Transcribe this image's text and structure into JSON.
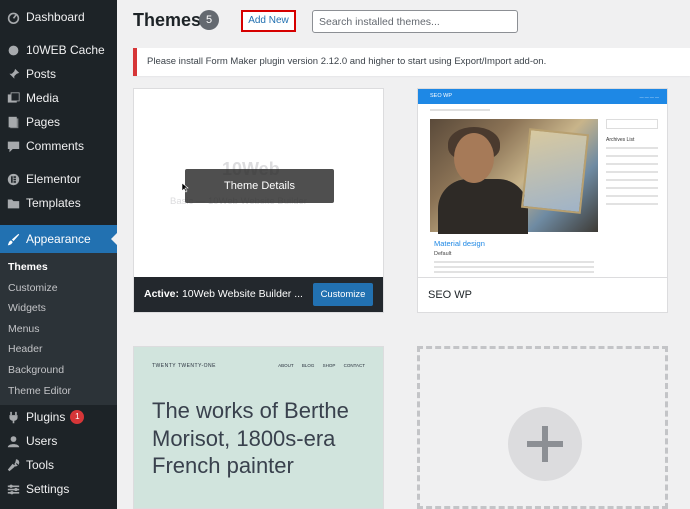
{
  "sidebar": {
    "items": [
      {
        "label": "Dashboard",
        "icon": "dashboard-icon"
      },
      {
        "label": "10WEB Cache",
        "icon": "cache-icon"
      },
      {
        "label": "Posts",
        "icon": "pin-icon"
      },
      {
        "label": "Media",
        "icon": "media-icon"
      },
      {
        "label": "Pages",
        "icon": "pages-icon"
      },
      {
        "label": "Comments",
        "icon": "comments-icon"
      },
      {
        "label": "Elementor",
        "icon": "elementor-icon"
      },
      {
        "label": "Templates",
        "icon": "folder-icon"
      },
      {
        "label": "Appearance",
        "icon": "brush-icon"
      },
      {
        "label": "Plugins",
        "icon": "plug-icon",
        "badge": "1"
      },
      {
        "label": "Users",
        "icon": "users-icon"
      },
      {
        "label": "Tools",
        "icon": "wrench-icon"
      },
      {
        "label": "Settings",
        "icon": "settings-icon"
      }
    ],
    "appearance_submenu": [
      "Themes",
      "Customize",
      "Widgets",
      "Menus",
      "Header",
      "Background",
      "Theme Editor"
    ]
  },
  "header": {
    "title": "Themes",
    "count": "5",
    "add_new": "Add New",
    "search_placeholder": "Search installed themes..."
  },
  "notice": {
    "text": "Please install Form Maker plugin version 2.12.0 and higher to start using Export/Import add-on."
  },
  "themes": {
    "active": {
      "details_label": "Theme Details",
      "watermark": "10Web",
      "faint_title": "Basic — 10Web Website Builder",
      "active_prefix": "Active:",
      "name": "10Web Website Builder ...",
      "customize_label": "Customize"
    },
    "seo": {
      "name": "SEO WP",
      "preview_brand": "SEO WP",
      "preview_post_title": "Material design",
      "preview_post_sub": "Default",
      "preview_widget_title": "Archives List"
    },
    "twenty_one": {
      "brand": "TWENTY TWENTY-ONE",
      "nav": [
        "ABOUT",
        "BLOG",
        "SHOP",
        "CONTACT"
      ],
      "heading": "The works of Berthe Morisot, 1800s-era French painter"
    }
  },
  "colors": {
    "sidebar_bg": "#1d2327",
    "accent": "#2271b1",
    "notice_border": "#d63638",
    "highlight_box": "#d60000"
  }
}
